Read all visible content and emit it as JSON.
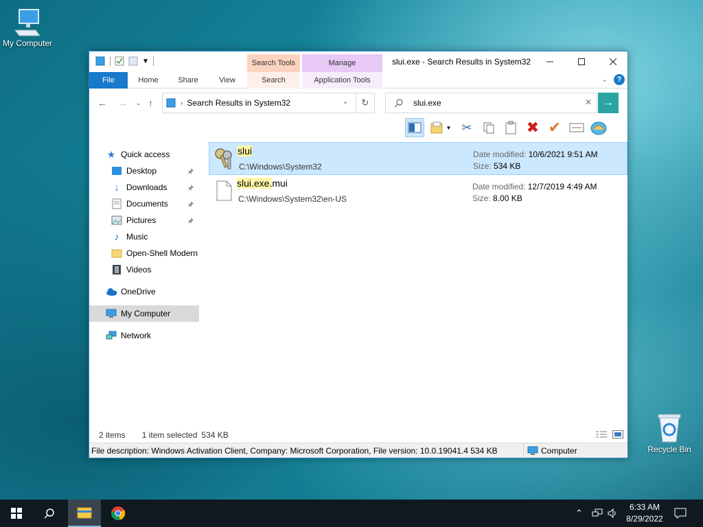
{
  "desktop": {
    "icons": [
      {
        "label": "My Computer"
      },
      {
        "label": "Recycle Bin"
      }
    ]
  },
  "window": {
    "title": "slui.exe - Search Results in System32",
    "contextual_groups": {
      "search_tools": "Search Tools",
      "manage": "Manage"
    },
    "tabs": {
      "file": "File",
      "home": "Home",
      "share": "Share",
      "view": "View",
      "search": "Search",
      "application_tools": "Application Tools"
    },
    "address": {
      "path": "Search Results in System32"
    },
    "search": {
      "value": "slui.exe"
    },
    "sidebar": {
      "items": [
        {
          "label": "Quick access"
        },
        {
          "label": "Desktop"
        },
        {
          "label": "Downloads"
        },
        {
          "label": "Documents"
        },
        {
          "label": "Pictures"
        },
        {
          "label": "Music"
        },
        {
          "label": "Open-Shell Modern"
        },
        {
          "label": "Videos"
        },
        {
          "label": "OneDrive"
        },
        {
          "label": "My Computer"
        },
        {
          "label": "Network"
        }
      ]
    },
    "results": [
      {
        "name_highlight": "slui",
        "name_rest": "",
        "path": "C:\\Windows\\System32",
        "date_label": "Date modified:",
        "date": "10/6/2021 9:51 AM",
        "size_label": "Size:",
        "size": "534 KB"
      },
      {
        "name_highlight": "slui.exe.",
        "name_rest": "mui",
        "path": "C:\\Windows\\System32\\en-US",
        "date_label": "Date modified:",
        "date": "12/7/2019 4:49 AM",
        "size_label": "Size:",
        "size": "8.00 KB"
      }
    ],
    "status": {
      "count": "2 items",
      "selected": "1 item selected",
      "selected_size": "534 KB"
    },
    "details": {
      "description": "File description: Windows Activation Client, Company: Microsoft Corporation, File version: 10.0.19041.4  534 KB",
      "location": "Computer"
    }
  },
  "taskbar": {
    "time": "6:33 AM",
    "date": "8/29/2022"
  },
  "colors": {
    "accent": "#1979ca",
    "selection": "#cce8ff",
    "highlight": "#fff7a6",
    "taskbar": "#101820"
  }
}
